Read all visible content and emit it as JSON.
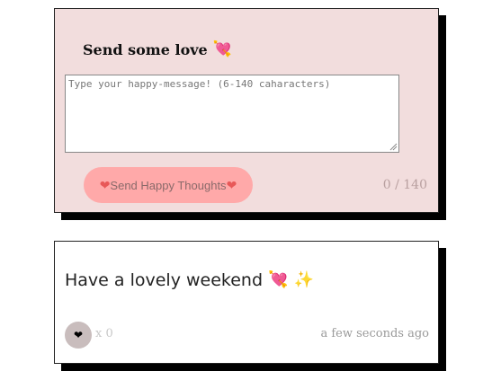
{
  "form": {
    "title": "Send some love",
    "title_emoji": "💘",
    "placeholder": "Type your happy-message! (6-140 caharacters)",
    "value": "",
    "button_label": "Send Happy Thoughts",
    "button_heart": "❤",
    "char_count": "0 / 140"
  },
  "message": {
    "text": "Have a lovely weekend",
    "emoji_1": "💘",
    "emoji_2": "✨",
    "like_heart": "❤",
    "like_count": "x 0",
    "timestamp": "a few seconds ago"
  },
  "colors": {
    "form_background": "#f2dddd",
    "button_background": "#ffa9a9",
    "like_button_background": "#c9bdbd",
    "shadow": "#000000"
  },
  "icons": {
    "title_icon": "heart-with-arrow-icon",
    "button_icon": "heart-icon",
    "like_icon": "heart-icon",
    "sparkles_icon": "sparkles-icon"
  }
}
